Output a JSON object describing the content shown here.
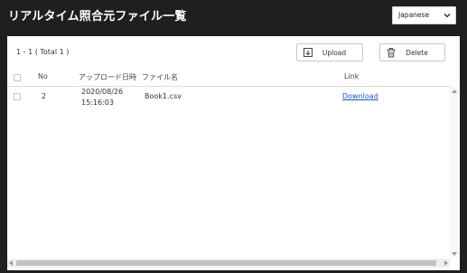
{
  "header": {
    "title": "リアルタイム照合元ファイル一覧",
    "language": {
      "selected": "Japanese",
      "icon": "chevron-down-icon"
    }
  },
  "toolbar": {
    "count_text": "1 - 1 ( Total 1 )",
    "upload_label": "Upload",
    "upload_icon": "upload-icon",
    "delete_label": "Delete",
    "delete_icon": "trash-icon"
  },
  "table": {
    "columns": [
      "No",
      "アップロード日時",
      "ファイル名",
      "Link"
    ],
    "rows": [
      {
        "no": "2",
        "date": "2020/08/26",
        "time": "15:16:03",
        "file": "Book1.csv",
        "link": "Download"
      }
    ]
  },
  "colors": {
    "header_bg": "#1f1f1f",
    "link": "#1a4fd6"
  }
}
